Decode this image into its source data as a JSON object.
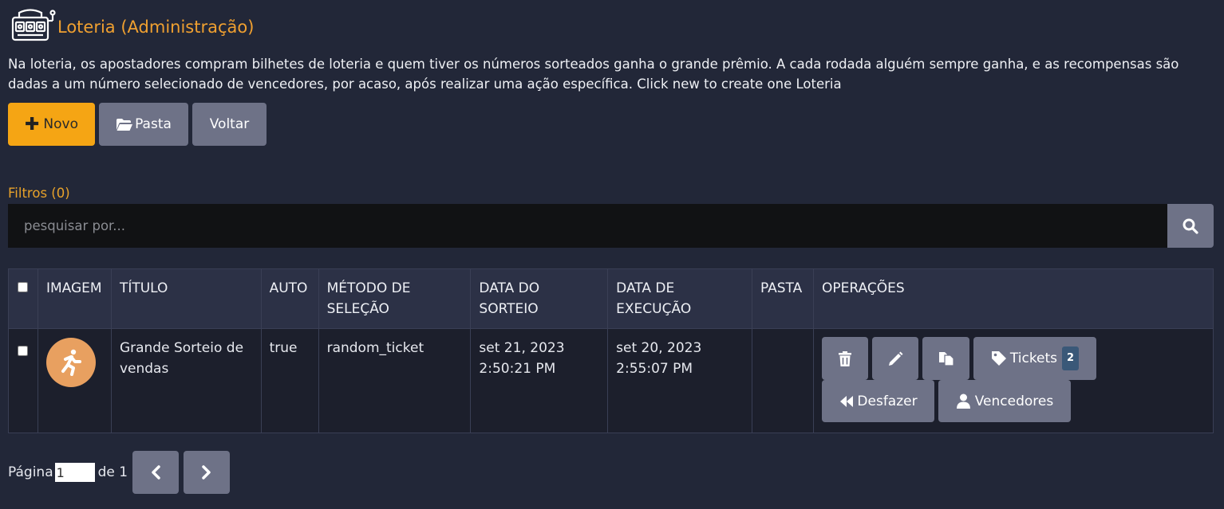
{
  "header": {
    "title": "Loteria (Administração)",
    "icon": "slot-machine-icon"
  },
  "description": "Na loteria, os apostadores compram bilhetes de loteria e quem tiver os números sorteados ganha o grande prêmio. A cada rodada alguém sempre ganha, e as recompensas são dadas a um número selecionado de vencedores, por acaso, após realizar uma ação específica. Click new to create one Loteria",
  "toolbar": {
    "new_label": "Novo",
    "folder_label": "Pasta",
    "back_label": "Voltar"
  },
  "filters": {
    "label": "Filtros (0)"
  },
  "search": {
    "placeholder": "pesquisar por..."
  },
  "table": {
    "headers": {
      "image": "IMAGEM",
      "title": "TÍTULO",
      "auto": "AUTO",
      "method_1": "MÉTODO DE",
      "method_2": "SELEÇÃO",
      "draw_1": "DATA DO",
      "draw_2": "SORTEIO",
      "exec_1": "DATA DE",
      "exec_2": "EXECUÇÃO",
      "folder": "PASTA",
      "ops": "OPERAÇÕES"
    },
    "rows": [
      {
        "title_1": "Grande Sorteio de",
        "title_2": "vendas",
        "auto": "true",
        "method": "random_ticket",
        "draw_date": "set 21, 2023",
        "draw_time": "2:50:21 PM",
        "exec_date": "set 20, 2023",
        "exec_time": "2:55:07 PM",
        "folder": "",
        "ops": {
          "tickets_label": "Tickets",
          "tickets_count": "2",
          "undo_label": "Desfazer",
          "winners_label": "Vencedores"
        }
      }
    ]
  },
  "pagination": {
    "page_label": "Página",
    "page_value": "1",
    "of_label": "de 1"
  },
  "colors": {
    "accent": "#f5a514",
    "background": "#222738",
    "button_gray": "#6e7287",
    "avatar": "#e8a060"
  }
}
